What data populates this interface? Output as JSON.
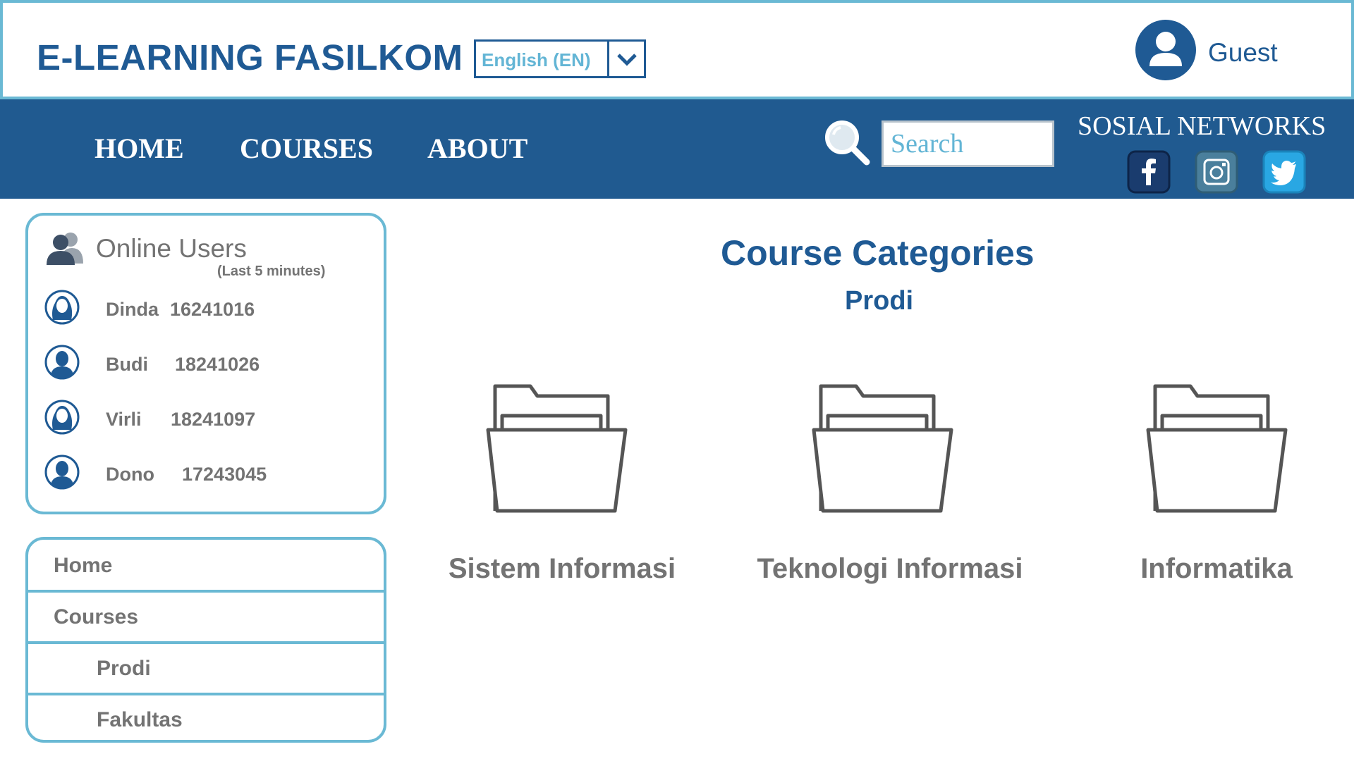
{
  "header": {
    "logo": "E-LEARNING FASILKOM",
    "language": "English (EN)",
    "user_name": "Guest"
  },
  "nav": {
    "items": [
      {
        "label": "HOME"
      },
      {
        "label": "COURSES"
      },
      {
        "label": "ABOUT"
      }
    ],
    "search_placeholder": "Search",
    "social_title": "SOSIAL NETWORKS",
    "social_icons": [
      "facebook-icon",
      "instagram-icon",
      "twitter-icon"
    ]
  },
  "online_users": {
    "title": "Online Users",
    "subtitle": "(Last 5 minutes)",
    "users": [
      {
        "name": "Dinda",
        "id": "16241016"
      },
      {
        "name": "Budi",
        "id": "18241026"
      },
      {
        "name": "Virli",
        "id": "18241097"
      },
      {
        "name": "Dono",
        "id": "17243045"
      }
    ]
  },
  "side_menu": {
    "items": [
      {
        "label": "Home"
      },
      {
        "label": "Courses"
      },
      {
        "label": "Prodi"
      },
      {
        "label": "Fakultas"
      }
    ]
  },
  "main": {
    "title": "Course Categories",
    "subtitle": "Prodi",
    "categories": [
      {
        "label": "Sistem Informasi"
      },
      {
        "label": "Teknologi Informasi"
      },
      {
        "label": "Informatika"
      }
    ]
  },
  "colors": {
    "brand_blue": "#1f5a94",
    "nav_blue": "#205a90",
    "accent_teal": "#6ab9d4",
    "text_gray": "#737373"
  }
}
